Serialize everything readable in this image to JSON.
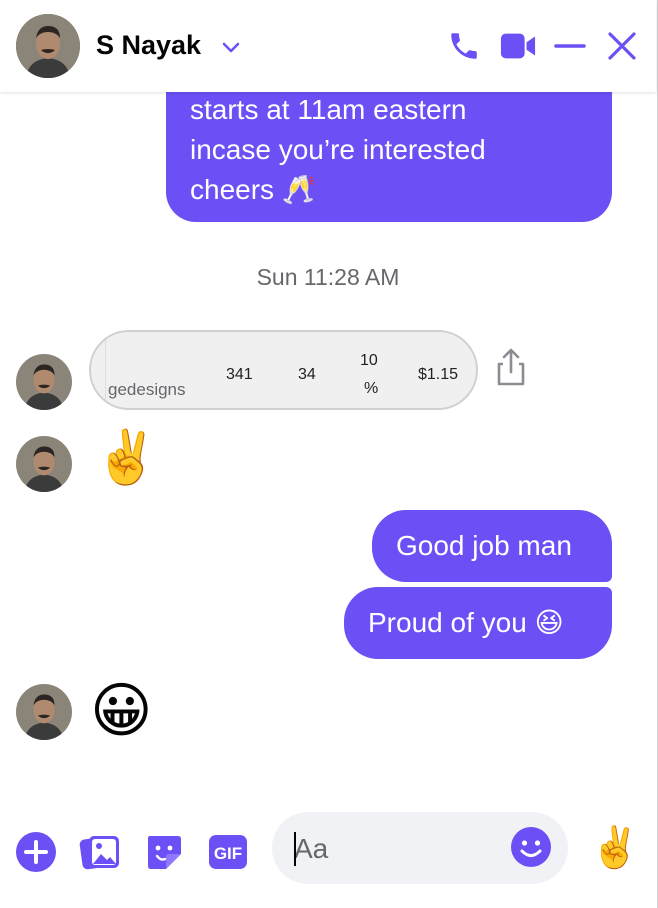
{
  "header": {
    "contact_name": "S Nayak",
    "icons": [
      "audio-call-icon",
      "video-call-icon",
      "minimize-icon",
      "close-icon"
    ],
    "accent_color": "#6c4ff5"
  },
  "conversation": {
    "top_message_lines": [
      "starts at 11am eastern",
      "incase you’re interested",
      "cheers 🥂"
    ],
    "timestamp": "Sun 11:28 AM",
    "link_card": {
      "source": "gedesigns",
      "values": [
        "341",
        "34",
        "10",
        "%",
        "$1.15"
      ]
    },
    "received_emoji_1": "✌️",
    "sent_messages": [
      "Good job man",
      "Proud of you 😆"
    ],
    "received_emoji_2": "😀"
  },
  "composer": {
    "placeholder": "Aa",
    "quick_reaction": "✌️",
    "gif_label": "GIF"
  }
}
